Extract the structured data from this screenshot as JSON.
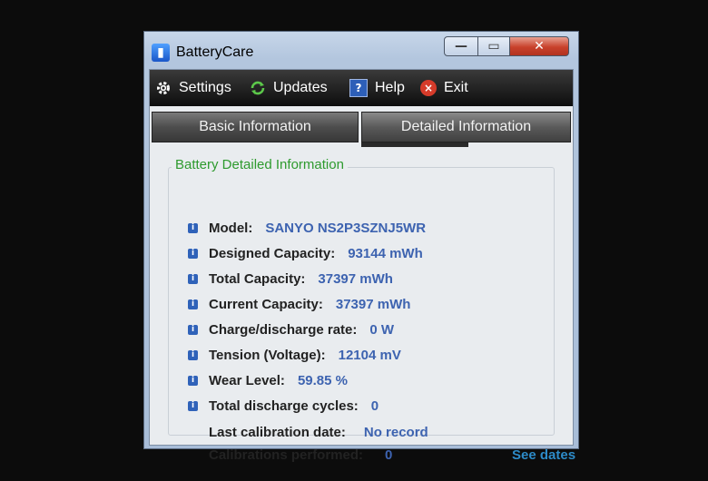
{
  "window": {
    "title": "BatteryCare",
    "controls": {
      "minimize": "—",
      "maximize": "▭",
      "close": "✕"
    }
  },
  "toolbar": {
    "items": [
      {
        "label": "Settings",
        "icon": "gear-icon"
      },
      {
        "label": "Updates",
        "icon": "refresh-icon"
      },
      {
        "label": "Help",
        "icon": "help-icon"
      },
      {
        "label": "Exit",
        "icon": "exit-icon"
      }
    ]
  },
  "tabs": [
    {
      "label": "Basic Information",
      "active": false
    },
    {
      "label": "Detailed Information",
      "active": true
    }
  ],
  "group": {
    "title": "Battery Detailed Information",
    "rows": [
      {
        "label": "Model:",
        "value": "SANYO NS2P3SZNJ5WR"
      },
      {
        "label": "Designed Capacity:",
        "value": "93144 mWh"
      },
      {
        "label": "Total Capacity:",
        "value": "37397 mWh"
      },
      {
        "label": "Current Capacity:",
        "value": "37397 mWh"
      },
      {
        "label": "Charge/discharge rate:",
        "value": "0 W"
      },
      {
        "label": "Tension (Voltage):",
        "value": "12104 mV"
      },
      {
        "label": "Wear Level:",
        "value": "59.85 %"
      },
      {
        "label": "Total discharge cycles:",
        "value": "0"
      }
    ],
    "calibration": {
      "last_label": "Last calibration date:",
      "last_value": "No record",
      "performed_label": "Calibrations performed:",
      "performed_value": "0",
      "see_dates": "See dates"
    }
  },
  "colors": {
    "group_title": "#2e9a2e",
    "value_text": "#3d63b0",
    "link": "#2d8bc8",
    "toolbar_bg": "#111111"
  }
}
